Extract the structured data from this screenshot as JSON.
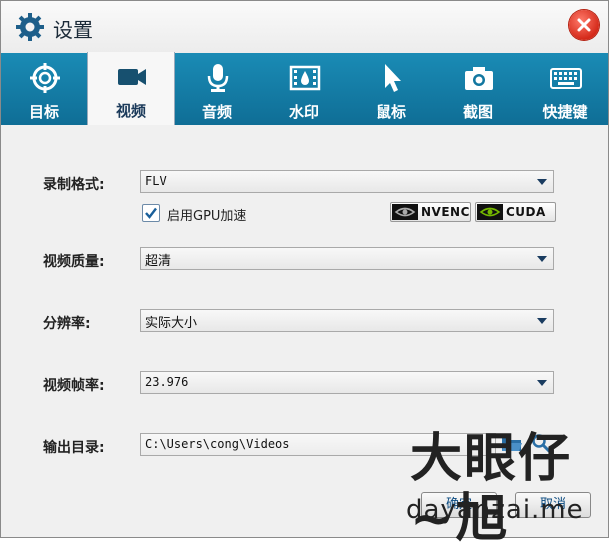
{
  "window": {
    "title": "设置"
  },
  "tabs": [
    {
      "label": "目标",
      "icon": "target-icon",
      "active": false
    },
    {
      "label": "视频",
      "icon": "video-camera-icon",
      "active": true
    },
    {
      "label": "音频",
      "icon": "microphone-icon",
      "active": false
    },
    {
      "label": "水印",
      "icon": "watermark-film-icon",
      "active": false
    },
    {
      "label": "鼠标",
      "icon": "mouse-cursor-icon",
      "active": false
    },
    {
      "label": "截图",
      "icon": "camera-icon",
      "active": false
    },
    {
      "label": "快捷键",
      "icon": "keyboard-icon",
      "active": false
    }
  ],
  "form": {
    "format": {
      "label": "录制格式:",
      "value": "FLV"
    },
    "gpu": {
      "label": "启用GPU加速",
      "checked": true,
      "nvenc": "NVENC",
      "cuda": "CUDA"
    },
    "quality": {
      "label": "视频质量:",
      "value": "超清"
    },
    "resolution": {
      "label": "分辨率:",
      "value": "实际大小"
    },
    "framerate": {
      "label": "视频帧率:",
      "value": "23.976"
    },
    "output": {
      "label": "输出目录:",
      "value": "C:\\Users\\cong\\Videos"
    }
  },
  "buttons": {
    "ok": "确定",
    "cancel": "取消"
  },
  "watermark": {
    "main": "大眼仔~旭",
    "sub": "dayanzai.me"
  },
  "colors": {
    "tab_bar": "#1480ab",
    "close": "#d42a1a",
    "nvidia_green": "#76b900"
  }
}
